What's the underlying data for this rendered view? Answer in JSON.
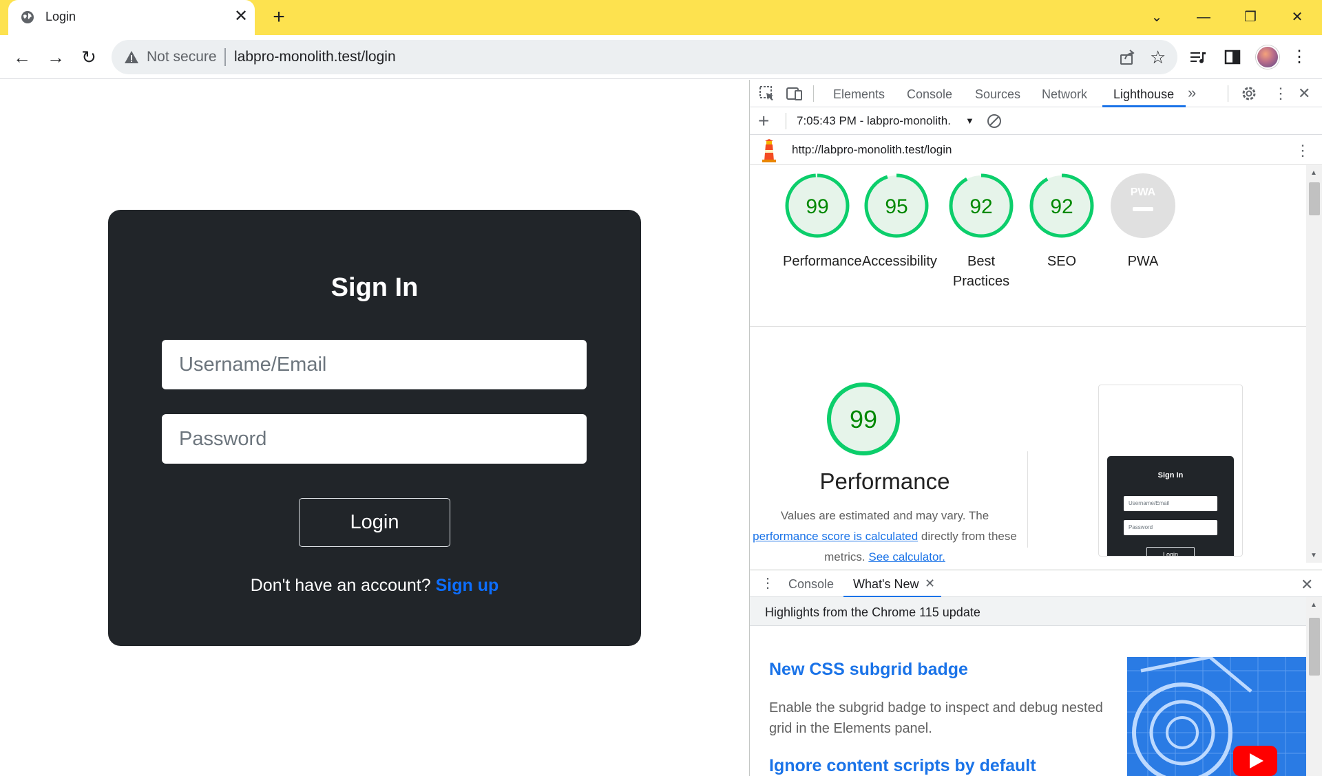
{
  "browser": {
    "tab_title": "Login",
    "not_secure": "Not secure",
    "url": "labpro-monolith.test/login",
    "colors": {
      "titlebar": "#fde24f",
      "accent": "#1a73e8"
    }
  },
  "page": {
    "title": "Sign In",
    "username_placeholder": "Username/Email",
    "password_placeholder": "Password",
    "login_label": "Login",
    "signup_prompt": "Don't have an account?",
    "signup_link": "Sign up"
  },
  "devtools": {
    "tabs": [
      "Elements",
      "Console",
      "Sources",
      "Network",
      "Lighthouse"
    ],
    "active_tab": "Lighthouse",
    "run_label": "7:05:43 PM - labpro-monolith.",
    "report_url": "http://labpro-monolith.test/login",
    "scores": [
      {
        "label": "Performance",
        "value": "99",
        "score": 99
      },
      {
        "label": "Accessibility",
        "value": "95",
        "score": 95
      },
      {
        "label": "Best Practices",
        "value": "92",
        "score": 92
      },
      {
        "label": "SEO",
        "value": "92",
        "score": 92
      },
      {
        "label": "PWA",
        "value": "PWA",
        "score": null
      }
    ],
    "perf_score": "99",
    "perf_title": "Performance",
    "perf_desc_1": "Values are estimated and may vary. The",
    "perf_link_1": "performance score is calculated",
    "perf_desc_2": "directly from these",
    "perf_desc_3": "metrics.",
    "perf_link_2": "See calculator.",
    "thumb": {
      "title": "Sign In",
      "username": "Username/Email",
      "password": "Password",
      "login": "Login"
    },
    "drawer": {
      "tabs": [
        "Console",
        "What's New"
      ],
      "active": "What's New",
      "highlights": "Highlights from the Chrome 115 update",
      "item1_title": "New CSS subgrid badge",
      "item1_desc": "Enable the subgrid badge to inspect and debug nested grid in the Elements panel.",
      "item2_title": "Ignore content scripts by default"
    }
  }
}
